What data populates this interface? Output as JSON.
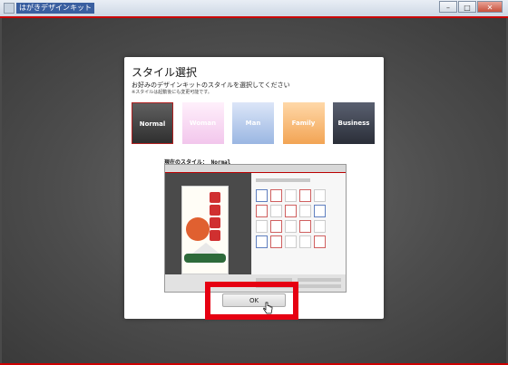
{
  "window": {
    "title": "はがきデザインキット",
    "controls": {
      "minimize": "–",
      "maximize": "□",
      "close": "✕"
    }
  },
  "dialog": {
    "title": "スタイル選択",
    "description": "お好みのデザインキットのスタイルを選択してください",
    "note": "※スタイルは起動後にも変更可能です。",
    "styles": [
      {
        "label": "Normal",
        "selected": true
      },
      {
        "label": "Woman"
      },
      {
        "label": "Man"
      },
      {
        "label": "Family"
      },
      {
        "label": "Business"
      }
    ],
    "current_style_label": "現在のスタイル： Normal",
    "ok_label": "OK"
  },
  "colors": {
    "accent": "#e60012",
    "window_title_bg": "#3a5fa0"
  },
  "icons": [
    "window-app-icon",
    "mouse-cursor-icon"
  ]
}
